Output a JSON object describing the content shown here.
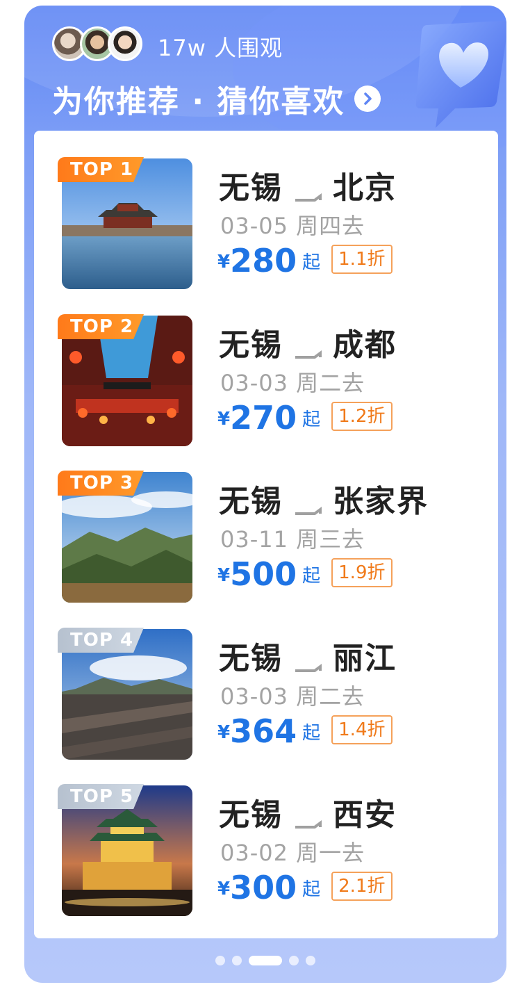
{
  "header": {
    "viewers_text": "17w 人围观",
    "title": "为你推荐 · 猜你喜欢",
    "avatars": [
      "avatar-1",
      "avatar-2",
      "avatar-3"
    ],
    "accent_color": "#5f86f4"
  },
  "items": [
    {
      "rank": "TOP 1",
      "route_from": "无锡",
      "route_to": "北京",
      "date": "03-05 周四去",
      "currency": "¥",
      "price": "280",
      "suffix": "起",
      "discount": "1.1折",
      "tag_color": "orange"
    },
    {
      "rank": "TOP 2",
      "route_from": "无锡",
      "route_to": "成都",
      "date": "03-03 周二去",
      "currency": "¥",
      "price": "270",
      "suffix": "起",
      "discount": "1.2折",
      "tag_color": "orange"
    },
    {
      "rank": "TOP 3",
      "route_from": "无锡",
      "route_to": "张家界",
      "date": "03-11 周三去",
      "currency": "¥",
      "price": "500",
      "suffix": "起",
      "discount": "1.9折",
      "tag_color": "orange"
    },
    {
      "rank": "TOP 4",
      "route_from": "无锡",
      "route_to": "丽江",
      "date": "03-03 周二去",
      "currency": "¥",
      "price": "364",
      "suffix": "起",
      "discount": "1.4折",
      "tag_color": "gray"
    },
    {
      "rank": "TOP 5",
      "route_from": "无锡",
      "route_to": "西安",
      "date": "03-02 周一去",
      "currency": "¥",
      "price": "300",
      "suffix": "起",
      "discount": "2.1折",
      "tag_color": "gray"
    }
  ],
  "pager": {
    "count": 5,
    "active_index": 2
  },
  "colors": {
    "price": "#1f74e4",
    "discount_border": "#f5a15a",
    "discount_text": "#f07a1a",
    "tag_orange": "#ff7a1a",
    "tag_gray": "#b6c1cf"
  }
}
